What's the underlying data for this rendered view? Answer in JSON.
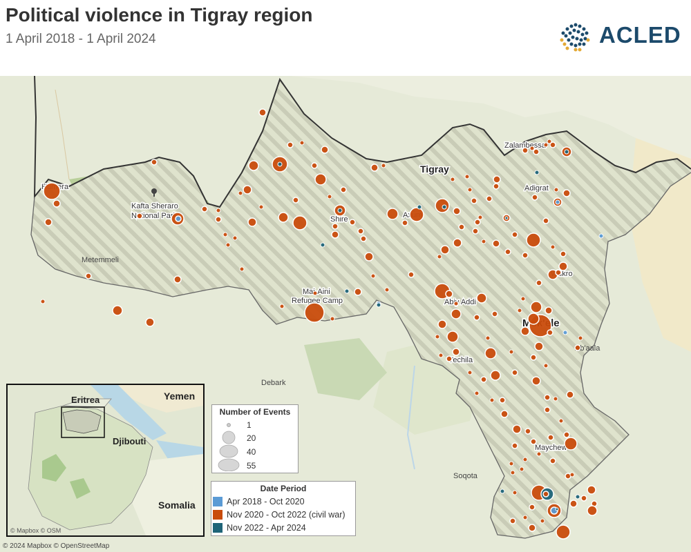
{
  "header": {
    "title": "Political violence in Tigray region",
    "subtitle": "1 April 2018 - 1 April 2024",
    "logo_text": "ACLED"
  },
  "map": {
    "region_label": "Tigray",
    "places": [
      {
        "name": "Humera",
        "style": "city"
      },
      {
        "name": "Kafta Sheraro",
        "style": "park"
      },
      {
        "name": "National Park",
        "style": "park"
      },
      {
        "name": "Metemmeli",
        "style": "town"
      },
      {
        "name": "Shire",
        "style": "city"
      },
      {
        "name": "Axum",
        "style": "city"
      },
      {
        "name": "Zalambessa",
        "style": "city"
      },
      {
        "name": "Adigrat",
        "style": "city"
      },
      {
        "name": "Wukro",
        "style": "city"
      },
      {
        "name": "Mai-Aini",
        "style": "city"
      },
      {
        "name": "Refugee Camp",
        "style": "city"
      },
      {
        "name": "Abiy Addi",
        "style": "city"
      },
      {
        "name": "Mek'ele",
        "style": "big"
      },
      {
        "name": "Ab'aala",
        "style": "town"
      },
      {
        "name": "Yechila",
        "style": "city"
      },
      {
        "name": "Debark",
        "style": "town"
      },
      {
        "name": "Maychew",
        "style": "city"
      },
      {
        "name": "Soqota",
        "style": "town"
      }
    ],
    "period_colors": {
      "p1": "#5b9bd5",
      "p2": "#c94c0c",
      "p3": "#1f6478"
    }
  },
  "inset": {
    "labels": [
      "Eritrea",
      "Yemen",
      "Djibouti",
      "Somalia"
    ],
    "attribution": "© Mapbox © OSM"
  },
  "legend_size": {
    "title": "Number of Events",
    "values": [
      "1",
      "20",
      "40",
      "55"
    ]
  },
  "legend_period": {
    "title": "Date Period",
    "items": [
      {
        "label": "Apr 2018 - Oct 2020",
        "color": "#5b9bd5"
      },
      {
        "label": "Nov 2020 - Oct 2022 (civil war)",
        "color": "#c94c0c"
      },
      {
        "label": "Nov 2022 - Apr 2024",
        "color": "#1f6478"
      }
    ]
  },
  "attribution": "© 2024 Mapbox © OpenStreetMap"
}
